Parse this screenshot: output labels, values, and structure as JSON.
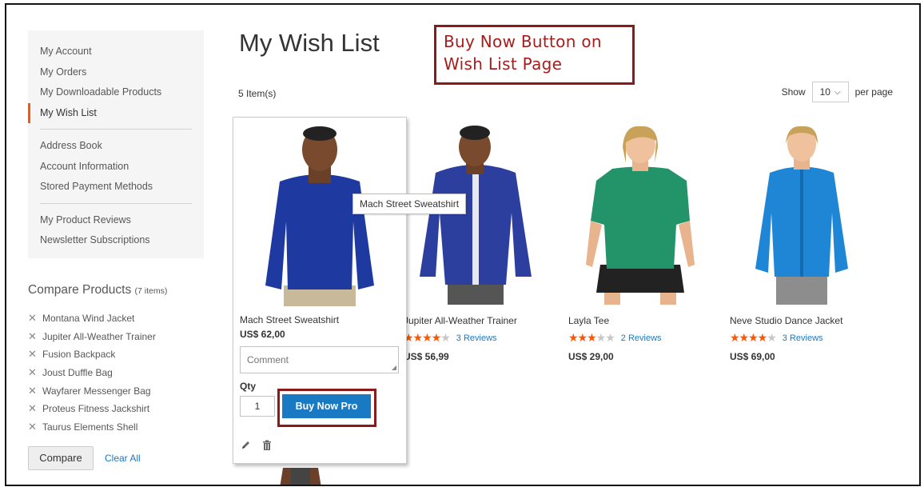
{
  "sidebar": {
    "items": [
      {
        "label": "My Account"
      },
      {
        "label": "My Orders"
      },
      {
        "label": "My Downloadable Products"
      },
      {
        "label": "My Wish List"
      },
      {
        "label": "Address Book"
      },
      {
        "label": "Account Information"
      },
      {
        "label": "Stored Payment Methods"
      },
      {
        "label": "My Product Reviews"
      },
      {
        "label": "Newsletter Subscriptions"
      }
    ],
    "current_index": 3,
    "accent_color": "#ff5501"
  },
  "compare": {
    "title": "Compare Products",
    "count": "(7 items)",
    "remove_icon": "x-icon",
    "items": [
      {
        "label": "Montana Wind Jacket"
      },
      {
        "label": "Jupiter All-Weather Trainer"
      },
      {
        "label": "Fusion Backpack"
      },
      {
        "label": "Joust Duffle Bag"
      },
      {
        "label": "Wayfarer Messenger Bag"
      },
      {
        "label": "Proteus Fitness Jackshirt"
      },
      {
        "label": "Taurus Elements Shell"
      }
    ],
    "compare_button": "Compare",
    "clear_all": "Clear All"
  },
  "main": {
    "title": "My Wish List",
    "callout": "Buy Now Button on Wish List Page",
    "callout_color": "#a61d1d",
    "items_count": "5 Item(s)",
    "limiter": {
      "show_label": "Show",
      "value": "10",
      "per_page_label": "per page"
    }
  },
  "hover_card": {
    "name": "Mach Street Sweatshirt",
    "price": "US$ 62,00",
    "comment_placeholder": "Comment",
    "qty_label": "Qty",
    "qty_value": "1",
    "buy_now_label": "Buy Now Pro",
    "button_color": "#1979c3",
    "edit_icon": "pencil-icon",
    "delete_icon": "trash-icon"
  },
  "tooltip": "Mach Street Sweatshirt",
  "products": [
    {
      "name": "Jupiter All-Weather Trainer",
      "rating": 4,
      "reviews": "3 Reviews",
      "price": "US$ 56,99",
      "shirt_color": "#2d3f9e"
    },
    {
      "name": "Layla Tee",
      "rating": 3,
      "reviews": "2 Reviews",
      "price": "US$ 29,00",
      "shirt_color": "#23946a"
    },
    {
      "name": "Neve Studio Dance Jacket",
      "rating": 4,
      "reviews": "3 Reviews",
      "price": "US$ 69,00",
      "shirt_color": "#1f86d6"
    }
  ]
}
